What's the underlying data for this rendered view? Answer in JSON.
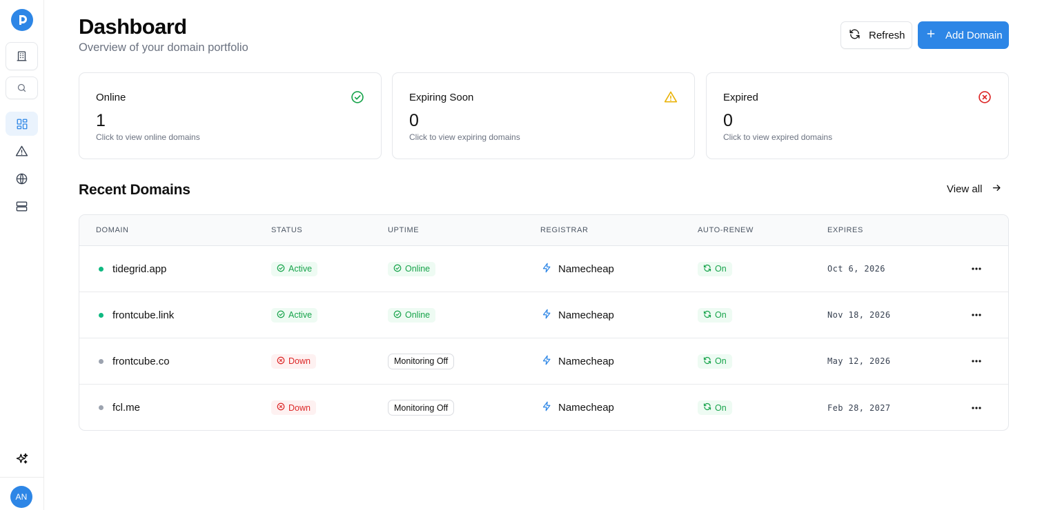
{
  "header": {
    "title": "Dashboard",
    "subtitle": "Overview of your domain portfolio",
    "refresh_label": "Refresh",
    "add_label": "Add Domain"
  },
  "sidebar": {
    "logo_icon": "logo-icon",
    "items": [
      {
        "name": "buildings-icon",
        "active": false
      },
      {
        "name": "search-icon",
        "active": false
      },
      {
        "name": "dashboard-grid-icon",
        "active": true
      },
      {
        "name": "warning-icon",
        "active": false
      },
      {
        "name": "globe-icon",
        "active": false
      },
      {
        "name": "server-icon",
        "active": false
      }
    ],
    "sparkle_icon": "sparkles-icon",
    "avatar_initials": "AN"
  },
  "stats": [
    {
      "label": "Online",
      "value": "1",
      "hint": "Click to view online domains",
      "icon": "check-circle-icon",
      "color": "#16a34a"
    },
    {
      "label": "Expiring Soon",
      "value": "0",
      "hint": "Click to view expiring domains",
      "icon": "warning-icon",
      "color": "#eab308"
    },
    {
      "label": "Expired",
      "value": "0",
      "hint": "Click to view expired domains",
      "icon": "x-circle-icon",
      "color": "#dc2626"
    }
  ],
  "recent": {
    "title": "Recent Domains",
    "view_all": "View all",
    "columns": [
      "DOMAIN",
      "STATUS",
      "UPTIME",
      "REGISTRAR",
      "AUTO-RENEW",
      "EXPIRES"
    ],
    "rows": [
      {
        "domain": "tidegrid.app",
        "dot_color": "#10b981",
        "status": "Active",
        "uptime": "Online",
        "registrar": "Namecheap",
        "auto_renew": "On",
        "expires": "Oct 6, 2026"
      },
      {
        "domain": "frontcube.link",
        "dot_color": "#10b981",
        "status": "Active",
        "uptime": "Online",
        "registrar": "Namecheap",
        "auto_renew": "On",
        "expires": "Nov 18, 2026"
      },
      {
        "domain": "frontcube.co",
        "dot_color": "#9ca3af",
        "status": "Down",
        "uptime": "Monitoring Off",
        "registrar": "Namecheap",
        "auto_renew": "On",
        "expires": "May 12, 2026"
      },
      {
        "domain": "fcl.me",
        "dot_color": "#9ca3af",
        "status": "Down",
        "uptime": "Monitoring Off",
        "registrar": "Namecheap",
        "auto_renew": "On",
        "expires": "Feb 28, 2027"
      }
    ]
  },
  "colors": {
    "accent": "#2d86e6",
    "success": "#16a34a",
    "danger": "#dc2626",
    "warning": "#eab308"
  }
}
